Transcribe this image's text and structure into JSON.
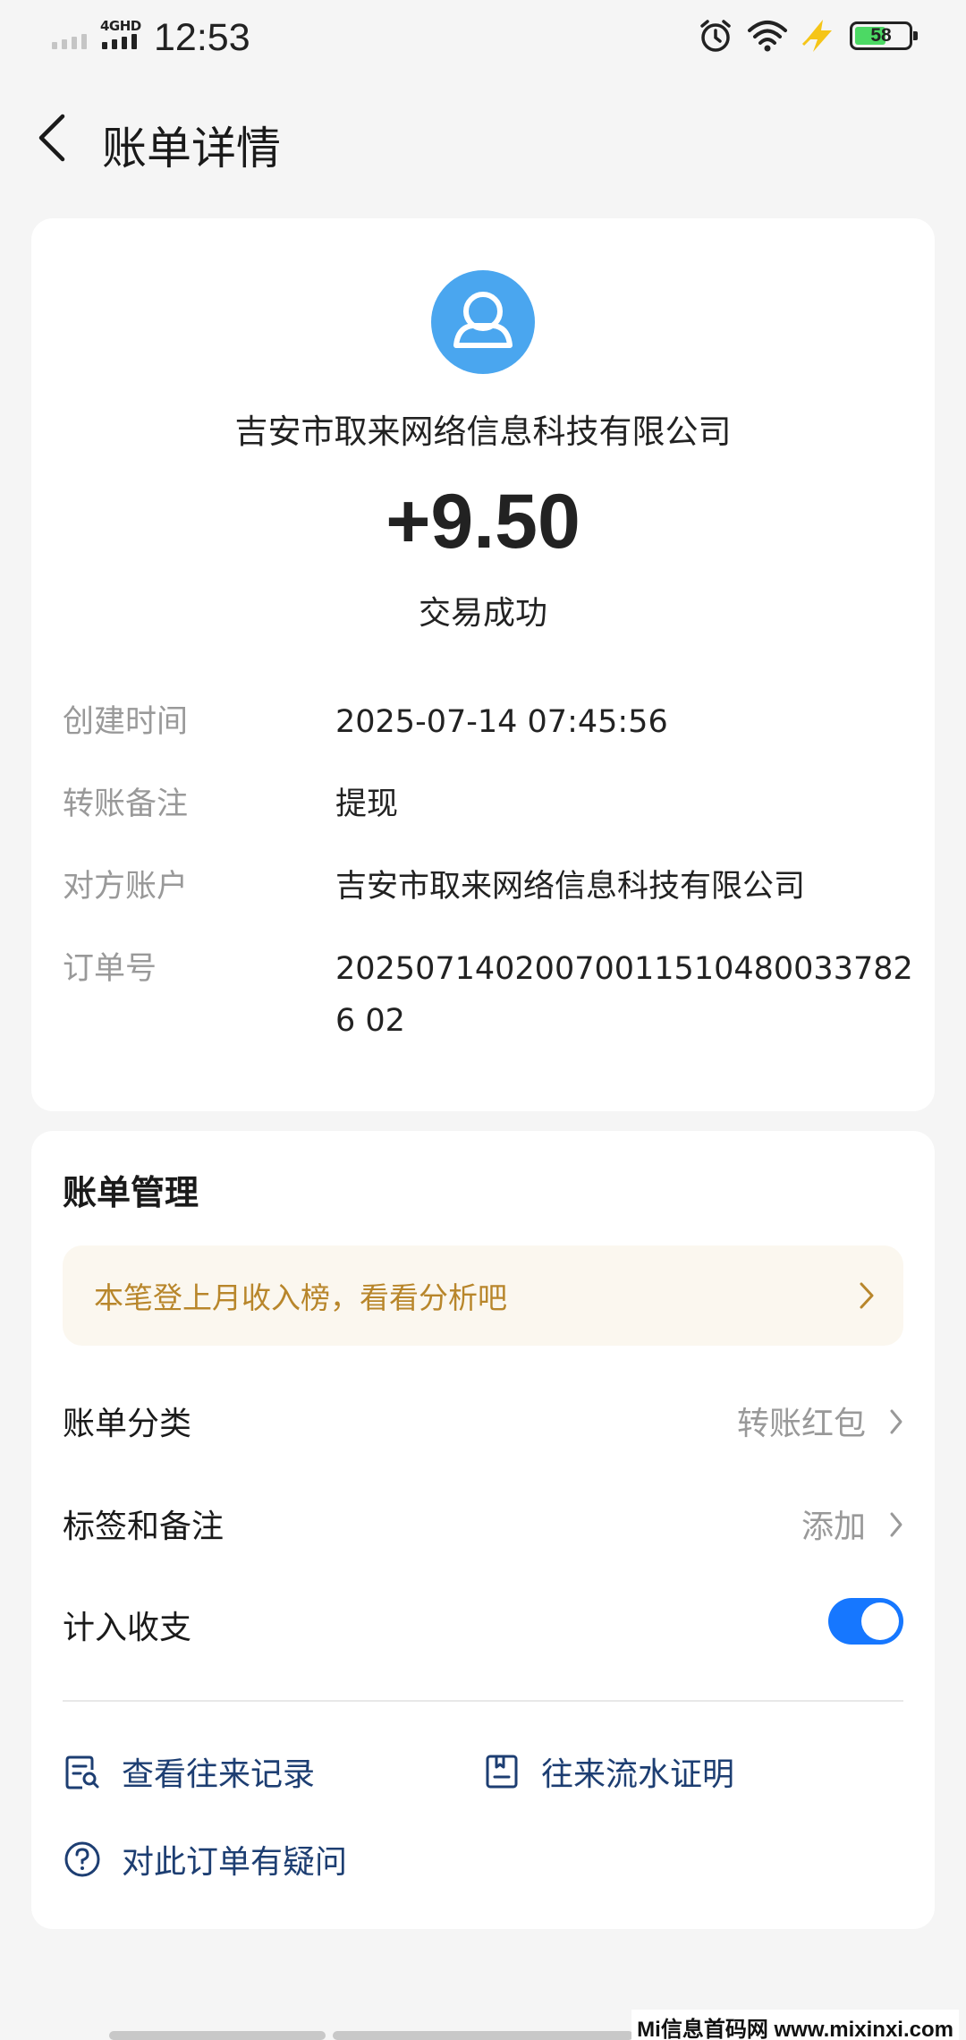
{
  "status_bar": {
    "network_label": "4GHD",
    "time": "12:53",
    "battery": "58",
    "battery_level": 0.58,
    "icons": [
      "alarm-icon",
      "wifi-icon",
      "charging-icon",
      "battery-icon"
    ]
  },
  "header": {
    "title": "账单详情",
    "back_icon": "back-chevron-icon"
  },
  "summary": {
    "avatar_icon": "person-icon",
    "avatar_color": "#4aa6ef",
    "merchant": "吉安市取来网络信息科技有限公司",
    "amount": "+9.50",
    "status": "交易成功"
  },
  "details": [
    {
      "label": "创建时间",
      "value": "2025-07-14 07:45:56"
    },
    {
      "label": "转账备注",
      "value": "提现"
    },
    {
      "label": "对方账户",
      "value": "吉安市取来网络信息科技有限公司"
    },
    {
      "label": "订单号",
      "value": "202507140200700115104800337826 02"
    }
  ],
  "manage": {
    "title": "账单管理",
    "promo": "本笔登上月收入榜，看看分析吧",
    "promo_color": "#b8862b",
    "category_label": "账单分类",
    "category_value": "转账红包",
    "tag_label": "标签和备注",
    "tag_value": "添加",
    "include_label": "计入收支",
    "include_enabled": true,
    "accent_color": "#1677ff",
    "links": [
      {
        "label": "查看往来记录",
        "icon": "record-search-icon"
      },
      {
        "label": "往来流水证明",
        "icon": "document-icon"
      },
      {
        "label": "对此订单有疑问",
        "icon": "question-icon"
      }
    ]
  },
  "watermark": "Mi信息首码网 www.mixinxi.com"
}
